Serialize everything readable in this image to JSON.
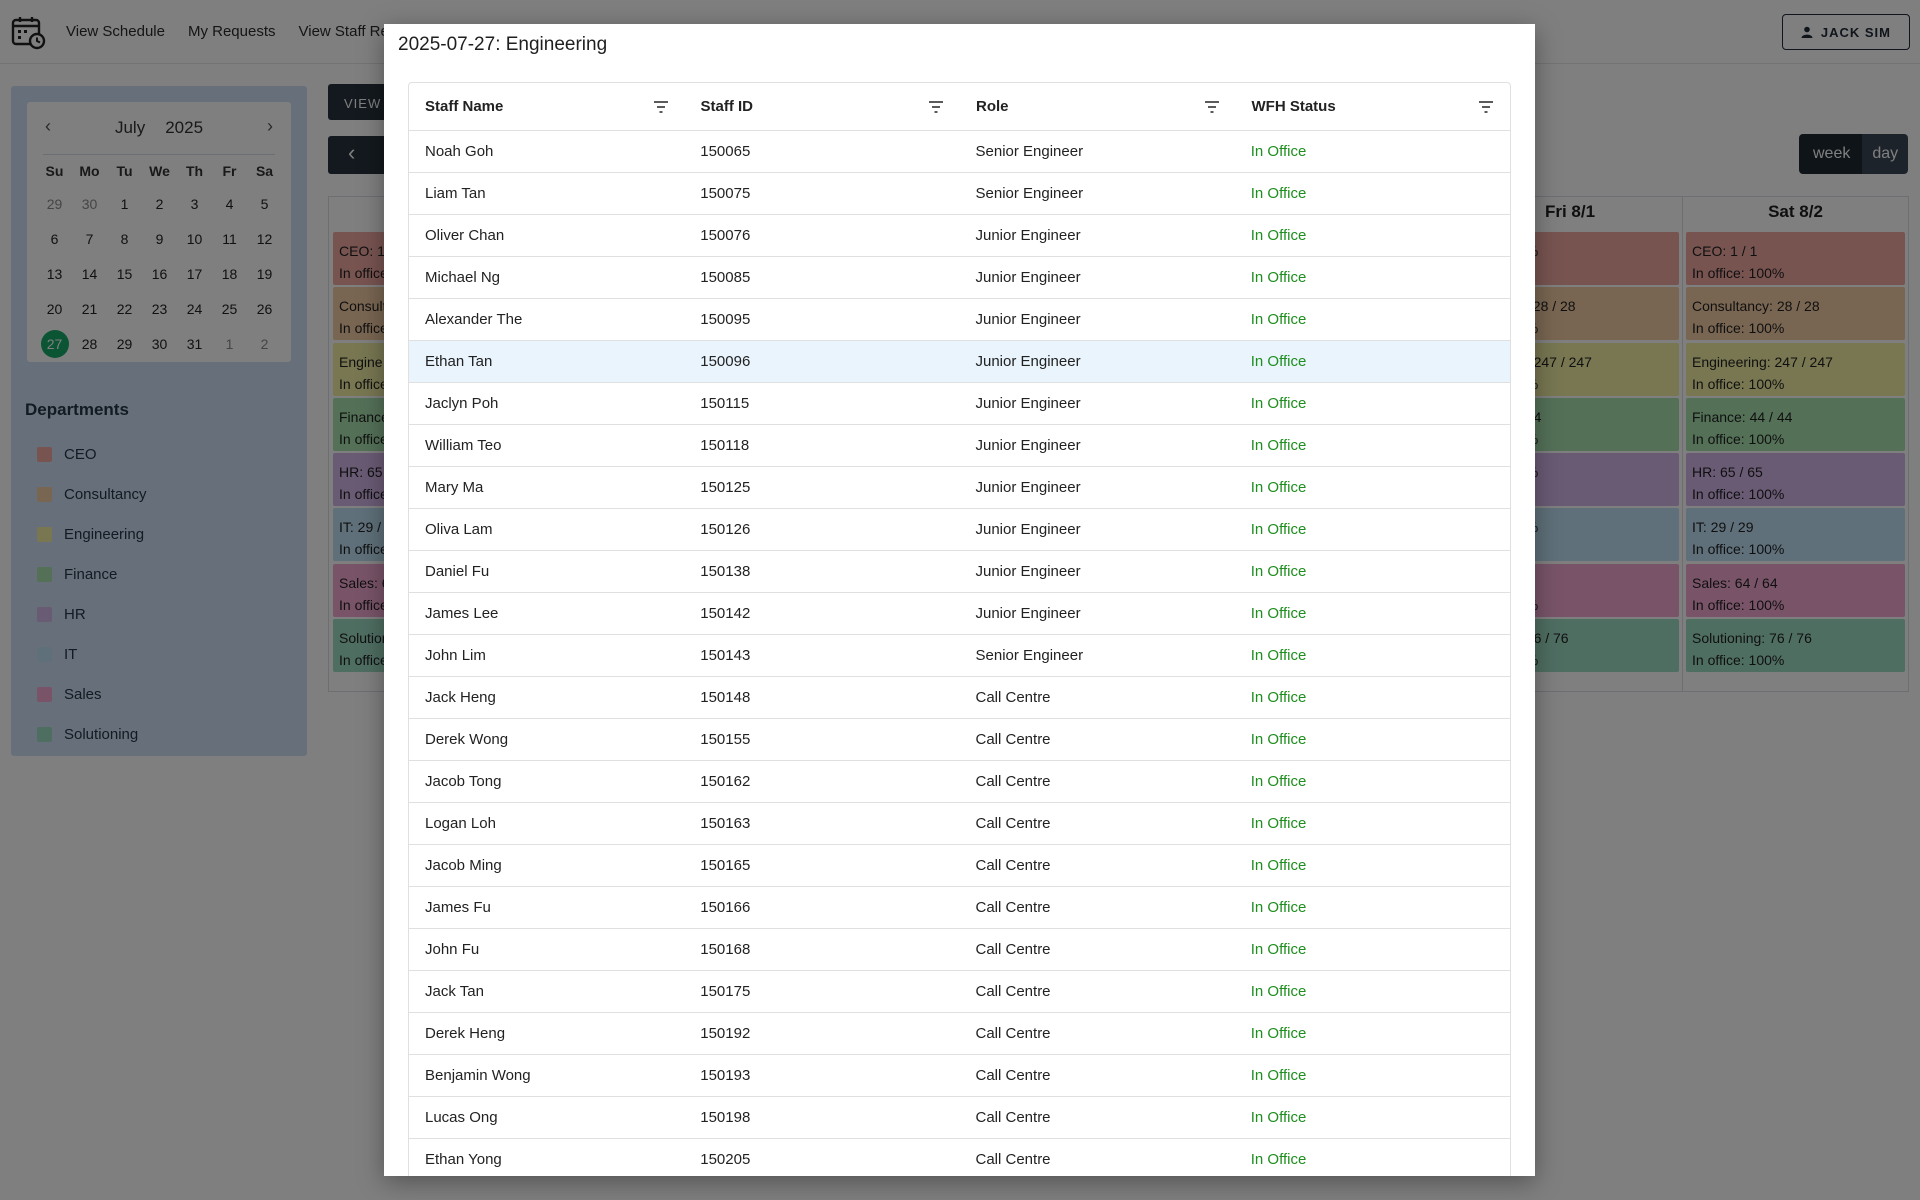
{
  "nav": {
    "links": [
      "View Schedule",
      "My Requests",
      "View Staff Re"
    ],
    "user": "JACK SIM"
  },
  "mini_calendar": {
    "month": "July",
    "year": "2025",
    "dow": [
      "Su",
      "Mo",
      "Tu",
      "We",
      "Th",
      "Fr",
      "Sa"
    ],
    "days": [
      {
        "d": "29",
        "o": true
      },
      {
        "d": "30",
        "o": true
      },
      {
        "d": "1"
      },
      {
        "d": "2"
      },
      {
        "d": "3"
      },
      {
        "d": "4"
      },
      {
        "d": "5"
      },
      {
        "d": "6"
      },
      {
        "d": "7"
      },
      {
        "d": "8"
      },
      {
        "d": "9"
      },
      {
        "d": "10"
      },
      {
        "d": "11"
      },
      {
        "d": "12"
      },
      {
        "d": "13"
      },
      {
        "d": "14"
      },
      {
        "d": "15"
      },
      {
        "d": "16"
      },
      {
        "d": "17"
      },
      {
        "d": "18"
      },
      {
        "d": "19"
      },
      {
        "d": "20"
      },
      {
        "d": "21"
      },
      {
        "d": "22"
      },
      {
        "d": "23"
      },
      {
        "d": "24"
      },
      {
        "d": "25"
      },
      {
        "d": "26"
      },
      {
        "d": "27",
        "sel": true
      },
      {
        "d": "28"
      },
      {
        "d": "29"
      },
      {
        "d": "30"
      },
      {
        "d": "31"
      },
      {
        "d": "1",
        "o": true
      },
      {
        "d": "2",
        "o": true
      }
    ]
  },
  "departments": {
    "title": "Departments",
    "items": [
      {
        "name": "CEO",
        "color": "#f0a9a3"
      },
      {
        "name": "Consultancy",
        "color": "#f2cda4"
      },
      {
        "name": "Engineering",
        "color": "#f1efa5"
      },
      {
        "name": "Finance",
        "color": "#a8e3b0"
      },
      {
        "name": "HR",
        "color": "#d4b6ea"
      },
      {
        "name": "IT",
        "color": "#bfe0f5"
      },
      {
        "name": "Sales",
        "color": "#f2a9d2"
      },
      {
        "name": "Solutioning",
        "color": "#9fdcc4"
      }
    ]
  },
  "toolbar": {
    "view_label": "VIEW",
    "prev_label": "‹",
    "week_label": "week",
    "day_label": "day"
  },
  "calendar": {
    "columns": [
      {
        "header": "",
        "cells": [
          {
            "text": "CEO: 1 /",
            "sub": "In office",
            "color": "#f0a9a3"
          },
          {
            "text": "Consult",
            "sub": "In office",
            "color": "#f2cda4"
          },
          {
            "text": "Engine",
            "sub": "In office",
            "color": "#f1efa5"
          },
          {
            "text": "Finance",
            "sub": "In office",
            "color": "#a8e3b0"
          },
          {
            "text": "HR: 65 /",
            "sub": "In office",
            "color": "#d4b6ea"
          },
          {
            "text": "IT: 29 /",
            "sub": "In office",
            "color": "#bfe0f5"
          },
          {
            "text": "Sales: 6",
            "sub": "In office",
            "color": "#f2a9d2"
          },
          {
            "text": "Solution",
            "sub": "In office",
            "color": "#9fdcc4"
          }
        ]
      },
      {
        "header": "Fri 8/1",
        "cells": [
          {
            "text": "",
            "sub": "0%",
            "color": "#f0a9a3"
          },
          {
            "text": "y: 28 / 28",
            "sub": "0%",
            "color": "#f2cda4"
          },
          {
            "text": "g: 247 / 247",
            "sub": "0%",
            "color": "#f1efa5"
          },
          {
            "text": "/ 44",
            "sub": "0%",
            "color": "#a8e3b0"
          },
          {
            "text": "",
            "sub": "0%",
            "color": "#d4b6ea"
          },
          {
            "text": "",
            "sub": "0%",
            "color": "#bfe0f5"
          },
          {
            "text": "64",
            "sub": "0%",
            "color": "#f2a9d2"
          },
          {
            "text": ": 76 / 76",
            "sub": "0%",
            "color": "#9fdcc4"
          }
        ]
      },
      {
        "header": "Sat 8/2",
        "cells": [
          {
            "text": "CEO: 1 / 1",
            "sub": "In office: 100%",
            "color": "#f0a9a3"
          },
          {
            "text": "Consultancy: 28 / 28",
            "sub": "In office: 100%",
            "color": "#f2cda4"
          },
          {
            "text": "Engineering: 247 / 247",
            "sub": "In office: 100%",
            "color": "#f1efa5"
          },
          {
            "text": "Finance: 44 / 44",
            "sub": "In office: 100%",
            "color": "#a8e3b0"
          },
          {
            "text": "HR: 65 / 65",
            "sub": "In office: 100%",
            "color": "#d4b6ea"
          },
          {
            "text": "IT: 29 / 29",
            "sub": "In office: 100%",
            "color": "#bfe0f5"
          },
          {
            "text": "Sales: 64 / 64",
            "sub": "In office: 100%",
            "color": "#f2a9d2"
          },
          {
            "text": "Solutioning: 76 / 76",
            "sub": "In office: 100%",
            "color": "#9fdcc4"
          }
        ]
      }
    ]
  },
  "modal": {
    "title": "2025-07-27: Engineering",
    "columns": [
      "Staff Name",
      "Staff ID",
      "Role",
      "WFH Status"
    ],
    "status_color": "#1e8e1e",
    "highlight_row": 5,
    "rows": [
      [
        "Noah Goh",
        "150065",
        "Senior Engineer",
        "In Office"
      ],
      [
        "Liam Tan",
        "150075",
        "Senior Engineer",
        "In Office"
      ],
      [
        "Oliver Chan",
        "150076",
        "Junior Engineer",
        "In Office"
      ],
      [
        "Michael Ng",
        "150085",
        "Junior Engineer",
        "In Office"
      ],
      [
        "Alexander The",
        "150095",
        "Junior Engineer",
        "In Office"
      ],
      [
        "Ethan Tan",
        "150096",
        "Junior Engineer",
        "In Office"
      ],
      [
        "Jaclyn Poh",
        "150115",
        "Junior Engineer",
        "In Office"
      ],
      [
        "William Teo",
        "150118",
        "Junior Engineer",
        "In Office"
      ],
      [
        "Mary Ma",
        "150125",
        "Junior Engineer",
        "In Office"
      ],
      [
        "Oliva Lam",
        "150126",
        "Junior Engineer",
        "In Office"
      ],
      [
        "Daniel Fu",
        "150138",
        "Junior Engineer",
        "In Office"
      ],
      [
        "James Lee",
        "150142",
        "Junior Engineer",
        "In Office"
      ],
      [
        "John Lim",
        "150143",
        "Senior Engineer",
        "In Office"
      ],
      [
        "Jack Heng",
        "150148",
        "Call Centre",
        "In Office"
      ],
      [
        "Derek Wong",
        "150155",
        "Call Centre",
        "In Office"
      ],
      [
        "Jacob Tong",
        "150162",
        "Call Centre",
        "In Office"
      ],
      [
        "Logan Loh",
        "150163",
        "Call Centre",
        "In Office"
      ],
      [
        "Jacob Ming",
        "150165",
        "Call Centre",
        "In Office"
      ],
      [
        "James Fu",
        "150166",
        "Call Centre",
        "In Office"
      ],
      [
        "John Fu",
        "150168",
        "Call Centre",
        "In Office"
      ],
      [
        "Jack Tan",
        "150175",
        "Call Centre",
        "In Office"
      ],
      [
        "Derek Heng",
        "150192",
        "Call Centre",
        "In Office"
      ],
      [
        "Benjamin Wong",
        "150193",
        "Call Centre",
        "In Office"
      ],
      [
        "Lucas Ong",
        "150198",
        "Call Centre",
        "In Office"
      ],
      [
        "Ethan Yong",
        "150205",
        "Call Centre",
        "In Office"
      ]
    ]
  }
}
